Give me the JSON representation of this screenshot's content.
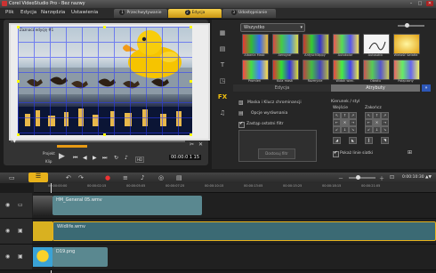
{
  "window": {
    "title": "Corel VideoStudio Pro - Bez nazwy",
    "minimize": "–",
    "maximize": "□",
    "close": "✕"
  },
  "menu": [
    {
      "label": "Plik",
      "x": 6
    },
    {
      "label": "Edycja",
      "x": 23
    },
    {
      "label": "Narzędzia",
      "x": 46
    },
    {
      "label": "Ustawienia",
      "x": 80
    }
  ],
  "steps": [
    {
      "num": "1",
      "label": "Przechwytywanie"
    },
    {
      "num": "2",
      "label": "Edycja"
    },
    {
      "num": "3",
      "label": "Udostępnianie"
    }
  ],
  "preview": {
    "overlay_label": "Zaznacz edycję #1",
    "project_label": "Projekt",
    "clip_label": "Klip",
    "timecode": "00:00:0 1 15",
    "hd_label": "HD"
  },
  "library": {
    "category": "Wszystko",
    "thumbs": [
      {
        "label": "Albania Mask"
      },
      {
        "label": "Aerograf"
      },
      {
        "label": "Antyschläppy"
      },
      {
        "label": "Autokolor"
      },
      {
        "label": "Autoszkic"
      },
      {
        "label": "Wielość światła"
      },
      {
        "label": "Promień"
      },
      {
        "label": "Kula mask"
      },
      {
        "label": "Rozmycie"
      },
      {
        "label": "Widok wiec."
      },
      {
        "label": "Obrotu"
      },
      {
        "label": "Połączony"
      }
    ],
    "tab_edit": "Edycja",
    "tab_attr": "Atrybuty"
  },
  "attributes": {
    "mask_label": "Maska i Klucz chrominancji",
    "align_label": "Opcje wyrównania",
    "apply_filter": "Zastąp ostatni filtr",
    "custom_filter": "Dostosuj filtr",
    "direction_title": "Kierunek / styl",
    "in_label": "Wejście",
    "out_label": "Zakończ",
    "show_grid": "Pokaż linie siatki"
  },
  "timeline": {
    "ruler": [
      "00:00:00:00",
      "00:00:02:15",
      "00:00:05:05",
      "00:00:07:25",
      "00:00:10:15",
      "00:00:13:05",
      "00:00:15:25",
      "00:00:18:15",
      "00:00:21:05"
    ],
    "duration": "0:00:10:30 ▲▼",
    "clips": [
      {
        "name": "HM_General 05.wmv",
        "track": "video"
      },
      {
        "name": "Wildlife.wmv",
        "track": "overlay"
      },
      {
        "name": "D19.png",
        "track": "overlay2"
      }
    ]
  }
}
